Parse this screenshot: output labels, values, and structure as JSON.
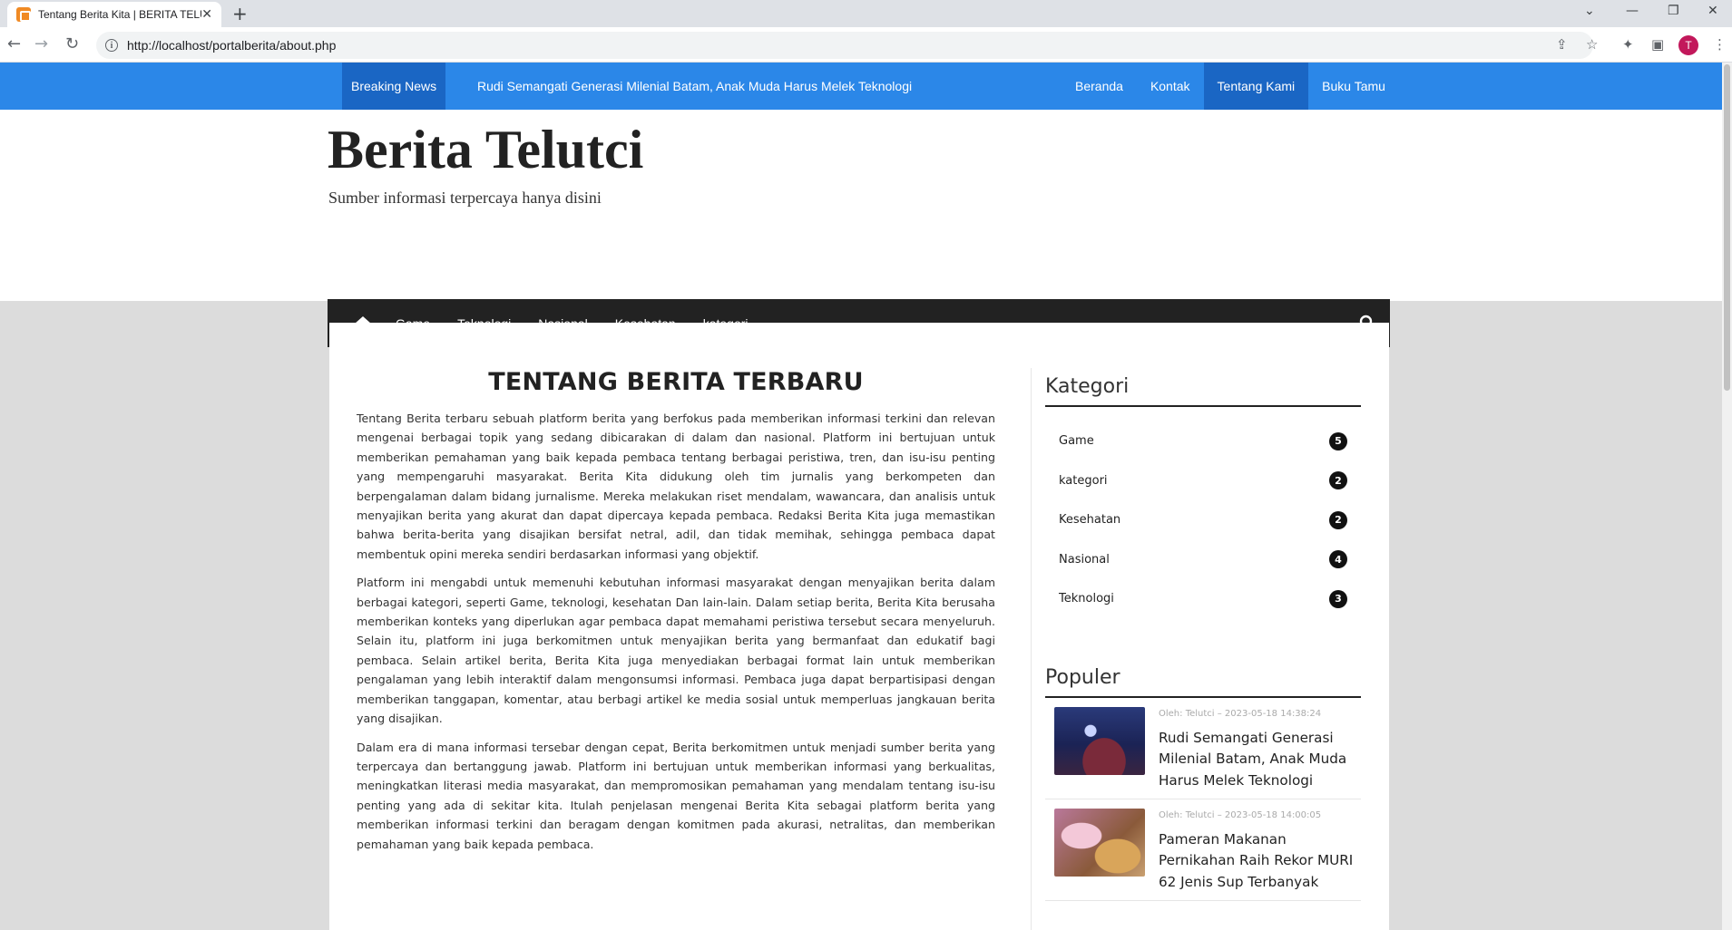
{
  "browser": {
    "tab_title": "Tentang Berita Kita | BERITA TELUTCI",
    "url": "http://localhost/portalberita/about.php",
    "avatar_letter": "T"
  },
  "topbar": {
    "breaking_label": "Breaking News",
    "ticker_text": "Rudi Semangati Generasi Milenial Batam, Anak Muda Harus Melek Teknologi",
    "nav": [
      "Beranda",
      "Kontak",
      "Tentang Kami",
      "Buku Tamu"
    ]
  },
  "header": {
    "site_title": "Berita Telutci",
    "site_tagline": "Sumber informasi terpercaya hanya disini"
  },
  "mainnav": [
    "Game",
    "Teknologi",
    "Nasional",
    "Kesehatan",
    "kategori"
  ],
  "article": {
    "heading": "TENTANG BERITA TERBARU",
    "paragraphs": [
      "Tentang Berita terbaru sebuah platform berita yang berfokus pada memberikan informasi terkini dan relevan mengenai berbagai topik yang sedang dibicarakan di dalam dan nasional. Platform ini bertujuan untuk memberikan pemahaman yang baik kepada pembaca tentang berbagai peristiwa, tren, dan isu-isu penting yang mempengaruhi masyarakat. Berita Kita didukung oleh tim jurnalis yang berkompeten dan berpengalaman dalam bidang jurnalisme. Mereka melakukan riset mendalam, wawancara, dan analisis untuk menyajikan berita yang akurat dan dapat dipercaya kepada pembaca. Redaksi Berita Kita juga memastikan bahwa berita-berita yang disajikan bersifat netral, adil, dan tidak memihak, sehingga pembaca dapat membentuk opini mereka sendiri berdasarkan informasi yang objektif.",
      "Platform ini mengabdi untuk memenuhi kebutuhan informasi masyarakat dengan menyajikan berita dalam berbagai kategori, seperti Game, teknologi, kesehatan Dan lain-lain. Dalam setiap berita, Berita Kita berusaha memberikan konteks yang diperlukan agar pembaca dapat memahami peristiwa tersebut secara menyeluruh. Selain itu, platform ini juga berkomitmen untuk menyajikan berita yang bermanfaat dan edukatif bagi pembaca. Selain artikel berita, Berita Kita juga menyediakan berbagai format lain untuk memberikan pengalaman yang lebih interaktif dalam mengonsumsi informasi. Pembaca juga dapat berpartisipasi dengan memberikan tanggapan, komentar, atau berbagi artikel ke media sosial untuk memperluas jangkauan berita yang disajikan.",
      "Dalam era di mana informasi tersebar dengan cepat, Berita berkomitmen untuk menjadi sumber berita yang terpercaya dan bertanggung jawab. Platform ini bertujuan untuk memberikan informasi yang berkualitas, meningkatkan literasi media masyarakat, dan mempromosikan pemahaman yang mendalam tentang isu-isu penting yang ada di sekitar kita. Itulah penjelasan mengenai Berita Kita sebagai platform berita yang memberikan informasi terkini dan beragam dengan komitmen pada akurasi, netralitas, dan memberikan pemahaman yang baik kepada pembaca."
    ]
  },
  "sidebar": {
    "kategori_title": "Kategori",
    "categories": [
      {
        "name": "Game",
        "count": "5"
      },
      {
        "name": "kategori",
        "count": "2"
      },
      {
        "name": "Kesehatan",
        "count": "2"
      },
      {
        "name": "Nasional",
        "count": "4"
      },
      {
        "name": "Teknologi",
        "count": "3"
      }
    ],
    "populer_title": "Populer",
    "populer": [
      {
        "meta": "Oleh: Telutci  –  2023-05-18 14:38:24",
        "title": "Rudi Semangati Generasi Milenial Batam, Anak Muda Harus Melek Teknologi"
      },
      {
        "meta": "Oleh: Telutci  –  2023-05-18 14:00:05",
        "title": "Pameran Makanan Pernikahan Raih Rekor MURI 62 Jenis Sup Terbanyak"
      }
    ]
  }
}
